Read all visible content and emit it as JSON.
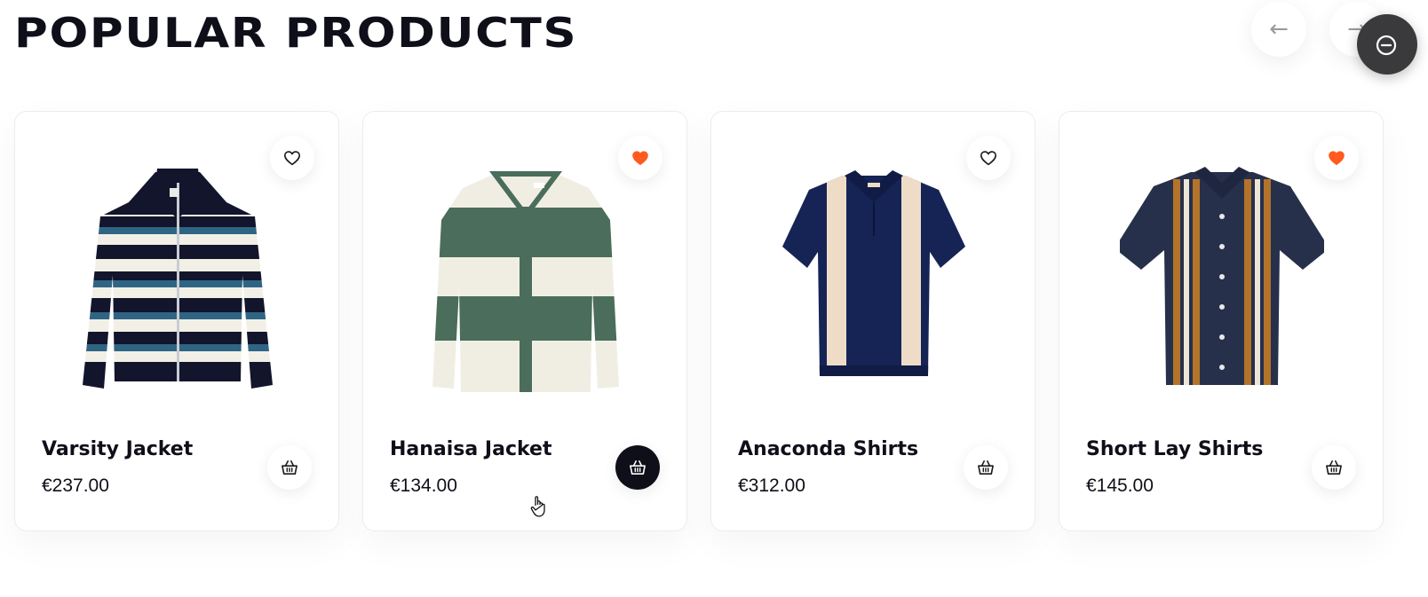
{
  "section": {
    "title": "POPULAR PRODUCTS"
  },
  "navigation": {
    "prev_icon": "arrow-left-icon",
    "next_icon": "arrow-right-icon",
    "prev_symbol": "←",
    "next_symbol": "→"
  },
  "colors": {
    "text": "#0f0f1a",
    "favorite_active": "#ff5a1f",
    "favorite_inactive": "#1a1a1a",
    "cart_active_bg": "#0f0f1a"
  },
  "products": [
    {
      "name": "Varsity Jacket",
      "price": "€237.00",
      "favorited": false,
      "cart_active": false
    },
    {
      "name": "Hanaisa Jacket",
      "price": "€134.00",
      "favorited": true,
      "cart_active": true
    },
    {
      "name": "Anaconda Shirts",
      "price": "€312.00",
      "favorited": false,
      "cart_active": false
    },
    {
      "name": "Short Lay Shirts",
      "price": "€145.00",
      "favorited": true,
      "cart_active": false
    }
  ]
}
